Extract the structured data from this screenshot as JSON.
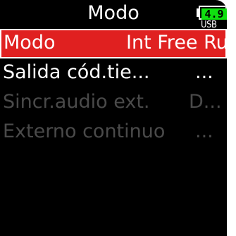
{
  "header": {
    "title": "Modo",
    "battery_level": "4.9",
    "power_source": "USB",
    "battery_color": "#10e010"
  },
  "menu": {
    "items": [
      {
        "label": "Modo",
        "value": "Int Free Run",
        "state": "selected"
      },
      {
        "label": "Salida cód.tie...",
        "value": "...",
        "state": "enabled"
      },
      {
        "label": "Sincr.audio ext.",
        "value": "D...",
        "state": "disabled"
      },
      {
        "label": "Externo continuo",
        "value": "...",
        "state": "disabled"
      }
    ]
  },
  "colors": {
    "background": "#000000",
    "selection": "#e02020",
    "text": "#ffffff",
    "disabled_text": "#4a4a4a"
  }
}
